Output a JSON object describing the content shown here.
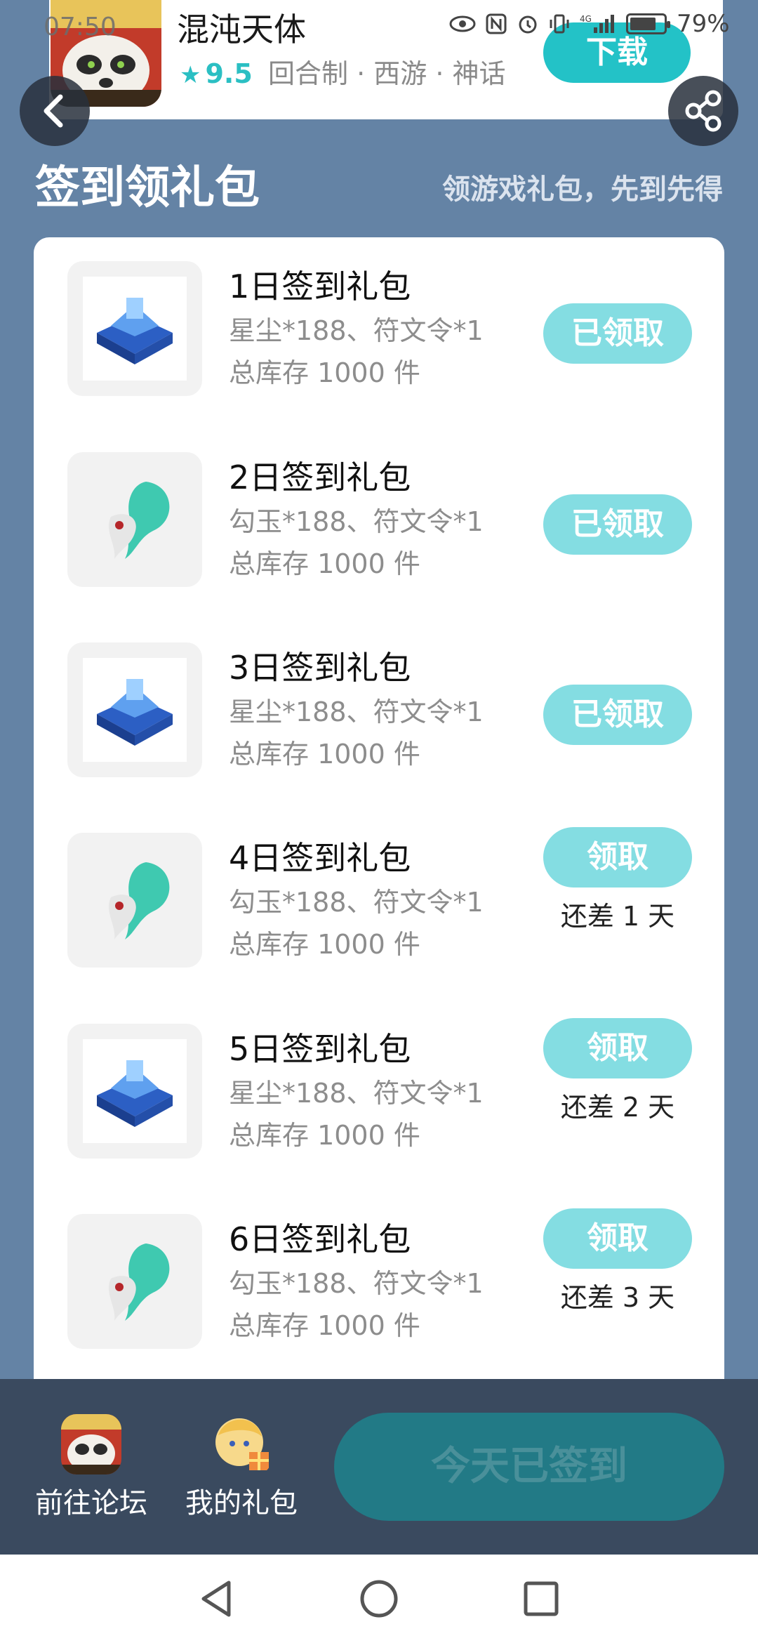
{
  "status_bar": {
    "time": "07:50",
    "battery": "79%",
    "battery_level": 0.79,
    "network": "4G"
  },
  "app": {
    "name": "混沌天体",
    "rating": "9.5",
    "tags": "回合制 · 西游 · 神话",
    "download_label": "下载"
  },
  "section": {
    "title": "签到领礼包",
    "subtitle": "领游戏礼包，先到先得"
  },
  "gifts": [
    {
      "name": "1日签到礼包",
      "content": "星尘*188、符文令*1",
      "stock": "总库存 1000 件",
      "button": "已领取",
      "remain": "",
      "icon": "star-dust-chest-icon"
    },
    {
      "name": "2日签到礼包",
      "content": "勾玉*188、符文令*1",
      "stock": "总库存 1000 件",
      "button": "已领取",
      "remain": "",
      "icon": "magatama-icon"
    },
    {
      "name": "3日签到礼包",
      "content": "星尘*188、符文令*1",
      "stock": "总库存 1000 件",
      "button": "已领取",
      "remain": "",
      "icon": "star-dust-chest-icon"
    },
    {
      "name": "4日签到礼包",
      "content": "勾玉*188、符文令*1",
      "stock": "总库存 1000 件",
      "button": "领取",
      "remain": "还差 1 天",
      "icon": "magatama-icon"
    },
    {
      "name": "5日签到礼包",
      "content": "星尘*188、符文令*1",
      "stock": "总库存 1000 件",
      "button": "领取",
      "remain": "还差 2 天",
      "icon": "star-dust-chest-icon"
    },
    {
      "name": "6日签到礼包",
      "content": "勾玉*188、符文令*1",
      "stock": "总库存 1000 件",
      "button": "领取",
      "remain": "还差 3 天",
      "icon": "magatama-icon"
    }
  ],
  "bottom_bar": {
    "forum_label": "前往论坛",
    "my_gifts_label": "我的礼包",
    "sign_label": "今天已签到"
  },
  "colors": {
    "page_bg": "#6483a5",
    "accent": "#23c2c7",
    "button_light": "#84dde2",
    "bottom_bg": "#3a4a5f",
    "signed_btn": "#227a86"
  }
}
